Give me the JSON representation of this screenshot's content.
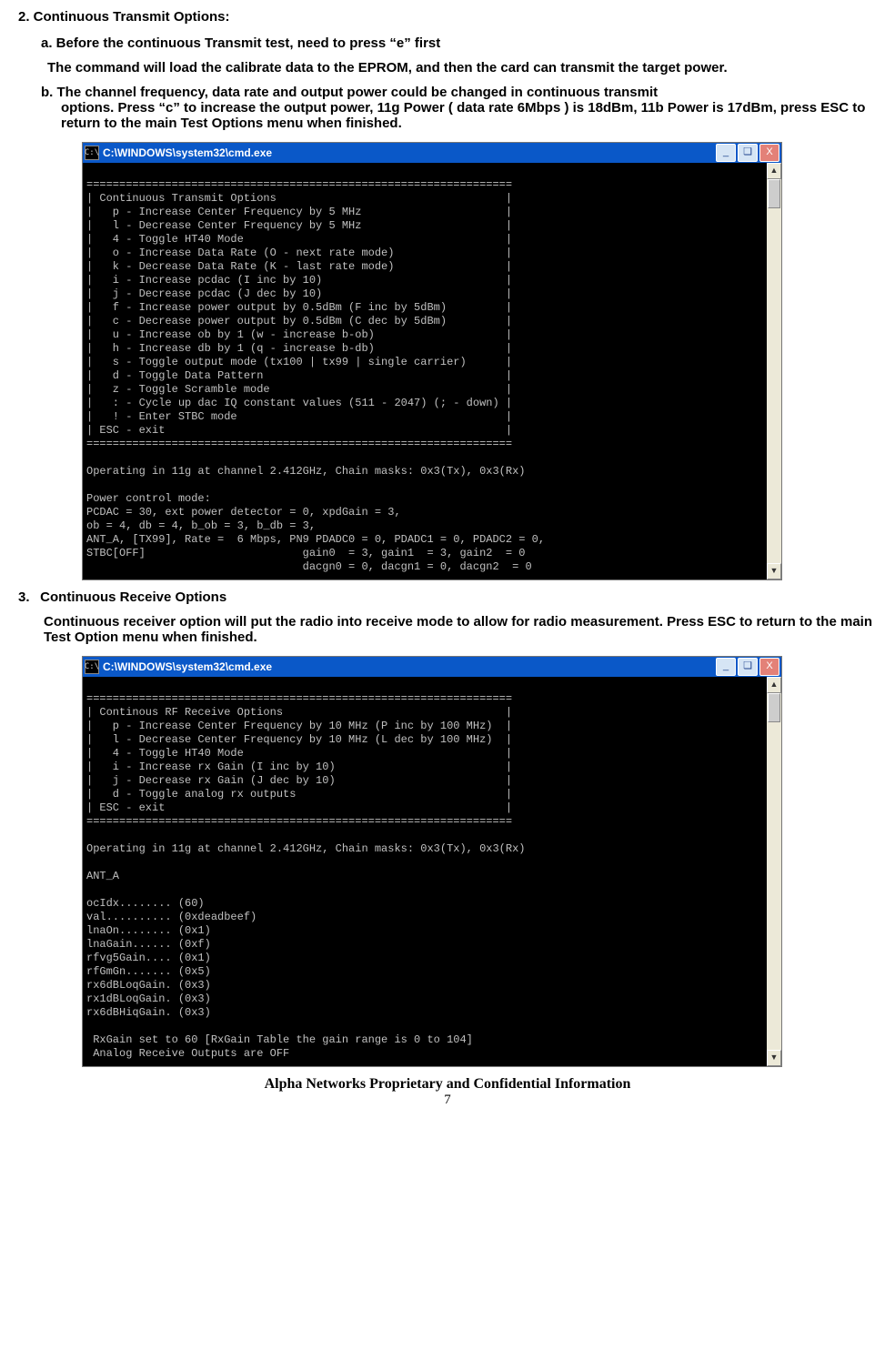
{
  "section2": {
    "heading": "2. Continuous Transmit Options:",
    "a": "a. Before the continuous Transmit test, need to press “e” first",
    "a_body": "The command will load the calibrate data to the EPROM, and then the card can transmit the target power.",
    "b_line1": "b. The channel frequency, data rate and output power could be changed in continuous transmit",
    "b_line2": "options. Press “c” to increase the output power, 11g Power ( data rate 6Mbps ) is 18dBm, 11b Power is 17dBm, press ESC to return to the main Test Options menu when finished."
  },
  "cmd1": {
    "title_icon": "C:\\",
    "title": "C:\\WINDOWS\\system32\\cmd.exe",
    "body": "\n=================================================================\n| Continuous Transmit Options                                   |\n|   p - Increase Center Frequency by 5 MHz                      |\n|   l - Decrease Center Frequency by 5 MHz                      |\n|   4 - Toggle HT40 Mode                                        |\n|   o - Increase Data Rate (O - next rate mode)                 |\n|   k - Decrease Data Rate (K - last rate mode)                 |\n|   i - Increase pcdac (I inc by 10)                            |\n|   j - Decrease pcdac (J dec by 10)                            |\n|   f - Increase power output by 0.5dBm (F inc by 5dBm)         |\n|   c - Decrease power output by 0.5dBm (C dec by 5dBm)         |\n|   u - Increase ob by 1 (w - increase b-ob)                    |\n|   h - Increase db by 1 (q - increase b-db)                    |\n|   s - Toggle output mode (tx100 | tx99 | single carrier)      |\n|   d - Toggle Data Pattern                                     |\n|   z - Toggle Scramble mode                                    |\n|   : - Cycle up dac IQ constant values (511 - 2047) (; - down) |\n|   ! - Enter STBC mode                                         |\n| ESC - exit                                                    |\n=================================================================\n\nOperating in 11g at channel 2.412GHz, Chain masks: 0x3(Tx), 0x3(Rx)\n\nPower control mode:\nPCDAC = 30, ext power detector = 0, xpdGain = 3,\nob = 4, db = 4, b_ob = 3, b_db = 3,\nANT_A, [TX99], Rate =  6 Mbps, PN9 PDADC0 = 0, PDADC1 = 0, PDADC2 = 0,\nSTBC[OFF]                        gain0  = 3, gain1  = 3, gain2  = 0\n                                 dacgn0 = 0, dacgn1 = 0, dacgn2  = 0"
  },
  "section3": {
    "heading_num": "3.",
    "heading": "Continuous Receive Options",
    "body": "Continuous receiver option will put the radio into receive mode to allow for radio measurement. Press ESC to return to the main Test Option menu when finished."
  },
  "cmd2": {
    "title_icon": "C:\\",
    "title": "C:\\WINDOWS\\system32\\cmd.exe",
    "body": "\n=================================================================\n| Continous RF Receive Options                                  |\n|   p - Increase Center Frequency by 10 MHz (P inc by 100 MHz)  |\n|   l - Decrease Center Frequency by 10 MHz (L dec by 100 MHz)  |\n|   4 - Toggle HT40 Mode                                        |\n|   i - Increase rx Gain (I inc by 10)                          |\n|   j - Decrease rx Gain (J dec by 10)                          |\n|   d - Toggle analog rx outputs                                |\n| ESC - exit                                                    |\n=================================================================\n\nOperating in 11g at channel 2.412GHz, Chain masks: 0x3(Tx), 0x3(Rx)\n\nANT_A\n\nocIdx........ (60)\nval.......... (0xdeadbeef)\nlnaOn........ (0x1)\nlnaGain...... (0xf)\nrfvg5Gain.... (0x1)\nrfGmGn....... (0x5)\nrx6dBLoqGain. (0x3)\nrx1dBLoqGain. (0x3)\nrx6dBHiqGain. (0x3)\n\n RxGain set to 60 [RxGain Table the gain range is 0 to 104]\n Analog Receive Outputs are OFF"
  },
  "footer": "Alpha Networks Proprietary and Confidential Information",
  "page_number": "7",
  "win_btns": {
    "min": "_",
    "max": "❏",
    "close": "X",
    "up": "▲",
    "down": "▼"
  }
}
